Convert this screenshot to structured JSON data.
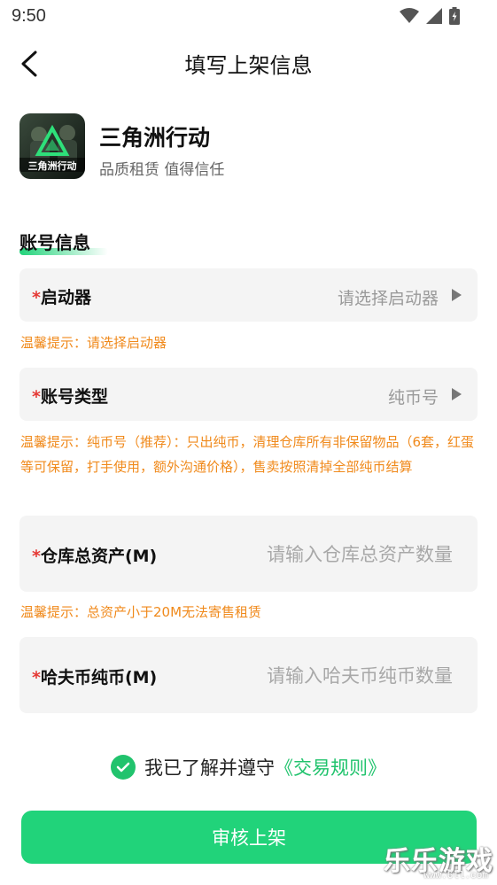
{
  "status_bar": {
    "time": "9:50",
    "icons": [
      "wifi-icon",
      "signal-icon",
      "battery-icon"
    ]
  },
  "nav": {
    "title": "填写上架信息",
    "back_icon": "chevron-left-icon"
  },
  "game": {
    "name": "三角洲行动",
    "subtitle": "品质租赁 值得信任",
    "logo_text": "三角洲行动"
  },
  "section": {
    "title": "账号信息"
  },
  "fields": {
    "launcher": {
      "required": "*",
      "label": "启动器",
      "value": "请选择启动器",
      "tip": "温馨提示：请选择启动器"
    },
    "account_type": {
      "required": "*",
      "label": "账号类型",
      "value": "纯币号",
      "tip": "温馨提示：纯币号（推荐）：只出纯币，清理仓库所有非保留物品（6套，红蛋等可保留，打手使用，额外沟通价格），售卖按照清掉全部纯币结算"
    },
    "warehouse": {
      "required": "*",
      "label": "仓库总资产(M)",
      "placeholder": "请输入仓库总资产数量",
      "tip": "温馨提示：总资产小于20M无法寄售租赁"
    },
    "hafu_coin": {
      "required": "*",
      "label": "哈夫币纯币(M)",
      "placeholder": "请输入哈夫币纯币数量"
    }
  },
  "agreement": {
    "text": "我已了解并遵守",
    "link": "《交易规则》",
    "checked": true
  },
  "submit": {
    "label": "审核上架"
  },
  "watermark": {
    "main": "乐乐游戏",
    "sub": "www.6ll.com"
  },
  "colors": {
    "accent": "#21d37a",
    "tip": "#f08a1c",
    "required": "#e53935"
  }
}
